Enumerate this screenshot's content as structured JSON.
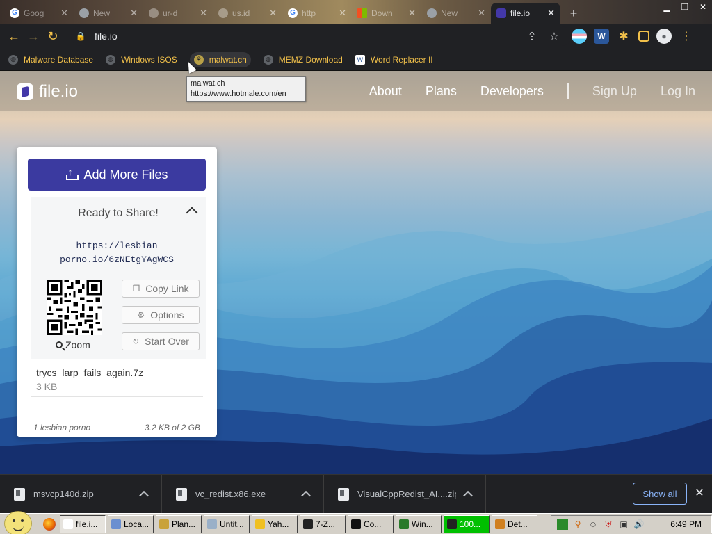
{
  "browser": {
    "tabs": [
      {
        "title": "Goog",
        "favicon": "google-icon",
        "active": false
      },
      {
        "title": "New",
        "favicon": "chrome-icon",
        "active": false
      },
      {
        "title": "ur-d",
        "favicon": "page-icon",
        "active": false
      },
      {
        "title": "us.id",
        "favicon": "page-icon",
        "active": false
      },
      {
        "title": "http",
        "favicon": "google-icon",
        "active": false
      },
      {
        "title": "Down",
        "favicon": "microsoft-icon",
        "active": false
      },
      {
        "title": "New",
        "favicon": "chrome-icon",
        "active": false
      },
      {
        "title": "file.io",
        "favicon": "fileio-icon",
        "active": true
      }
    ],
    "new_tab_glyph": "+",
    "address": "file.io",
    "bookmarks": [
      {
        "label": "Malware Database",
        "icon": "globe-icon"
      },
      {
        "label": "Windows ISOS",
        "icon": "globe-icon"
      },
      {
        "label": "malwat.ch",
        "icon": "malwatch-icon"
      },
      {
        "label": "MEMZ Download",
        "icon": "globe-icon"
      },
      {
        "label": "Word Replacer II",
        "icon": "word-replacer-icon"
      }
    ],
    "tooltip": {
      "title": "malwat.ch",
      "url": "https://www.hotmale.com/en"
    }
  },
  "site": {
    "logo": "file.io",
    "nav": [
      "About",
      "Plans",
      "Developers"
    ],
    "auth": [
      "Sign Up",
      "Log In"
    ]
  },
  "card": {
    "add_button": "Add More Files",
    "share_title": "Ready to Share!",
    "link_line1": "https://lesbian",
    "link_line2": "porno.io/6zNEtgYAgWCS",
    "zoom_label": "Zoom",
    "actions": {
      "copy": "Copy Link",
      "options": "Options",
      "start_over": "Start Over"
    },
    "file": {
      "name": "trycs_larp_fails_again.7z",
      "size": "3 KB"
    },
    "footer_left": "1 lesbian porno",
    "footer_right": "3.2 KB of 2 GB"
  },
  "downloads": {
    "items": [
      "msvcp140d.zip",
      "vc_redist.x86.exe",
      "VisualCppRedist_AI....zip"
    ],
    "show_all": "Show all"
  },
  "taskbar": {
    "buttons": [
      {
        "label": "file.i...",
        "pressed": true,
        "color": "#ffffff"
      },
      {
        "label": "Loca...",
        "pressed": false,
        "color": "#6a8fd0"
      },
      {
        "label": "Plan...",
        "pressed": false,
        "color": "#c9a23a"
      },
      {
        "label": "Untit...",
        "pressed": false,
        "color": "#9ab0c8"
      },
      {
        "label": "Yah...",
        "pressed": false,
        "color": "#f0c020"
      },
      {
        "label": "7-Z...",
        "pressed": false,
        "color": "#222222"
      },
      {
        "label": "Co...",
        "pressed": false,
        "color": "#111111"
      },
      {
        "label": "Win...",
        "pressed": false,
        "color": "#2a7a2a"
      },
      {
        "label": "100...",
        "pressed": false,
        "color": "#222222",
        "green": true
      },
      {
        "label": "Det...",
        "pressed": false,
        "color": "#d08020"
      }
    ],
    "clock": "6:49 PM"
  }
}
